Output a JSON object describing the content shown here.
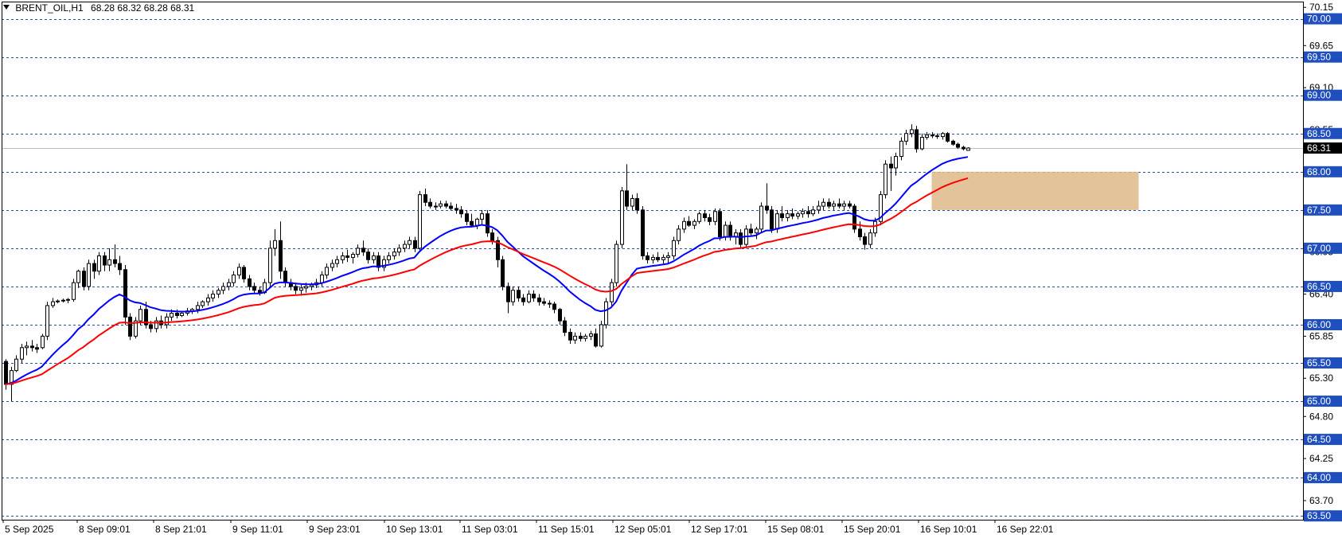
{
  "header": {
    "symbol": "BRENT_OIL,H1",
    "ohlc": "68.28 68.32 68.28 68.31"
  },
  "colors": {
    "background": "#ffffff",
    "level_line": "#1f4fbf",
    "bid_line": "#c0c0c0",
    "ma_fast": "#0000ff",
    "ma_slow": "#ff0000",
    "zone": "#deb887",
    "candle_bull": "#ffffff",
    "candle_bear": "#000000",
    "price_box": "#000000"
  },
  "chart_data": {
    "type": "candlestick",
    "symbol": "BRENT_OIL",
    "timeframe": "H1",
    "ylim": [
      63.5,
      70.15
    ],
    "y_ticks": [
      "70.15",
      "69.65",
      "69.10",
      "68.55",
      "68.00",
      "67.50",
      "66.95",
      "66.40",
      "65.85",
      "65.30",
      "64.80",
      "64.25",
      "63.70"
    ],
    "levels": [
      "70.00",
      "69.50",
      "69.00",
      "68.50",
      "68.00",
      "67.50",
      "67.00",
      "66.50",
      "66.00",
      "65.50",
      "65.00",
      "64.50",
      "64.00",
      "63.50"
    ],
    "current_price": "68.31",
    "x_labels": [
      "5 Sep 2025",
      "8 Sep 09:01",
      "8 Sep 21:01",
      "9 Sep 11:01",
      "9 Sep 23:01",
      "10 Sep 13:01",
      "11 Sep 03:01",
      "11 Sep 15:01",
      "12 Sep 05:01",
      "12 Sep 17:01",
      "15 Sep 08:01",
      "15 Sep 20:01",
      "16 Sep 10:01",
      "16 Sep 22:01"
    ],
    "zone": {
      "x_from": 179,
      "x_to": 219,
      "y_low": 67.5,
      "y_high": 68.0
    },
    "candles": [
      [
        65.52,
        65.55,
        65.15,
        65.22
      ],
      [
        65.22,
        65.45,
        65.0,
        65.4
      ],
      [
        65.4,
        65.6,
        65.38,
        65.55
      ],
      [
        65.55,
        65.75,
        65.5,
        65.7
      ],
      [
        65.7,
        65.78,
        65.6,
        65.72
      ],
      [
        65.72,
        65.8,
        65.65,
        65.7
      ],
      [
        65.7,
        65.75,
        65.63,
        65.68
      ],
      [
        65.7,
        65.88,
        65.68,
        65.85
      ],
      [
        65.85,
        66.3,
        65.8,
        66.25
      ],
      [
        66.25,
        66.35,
        66.22,
        66.3
      ],
      [
        66.3,
        66.33,
        66.28,
        66.31
      ],
      [
        66.31,
        66.34,
        66.29,
        66.32
      ],
      [
        66.32,
        66.35,
        66.28,
        66.33
      ],
      [
        66.33,
        66.6,
        66.3,
        66.55
      ],
      [
        66.55,
        66.72,
        66.48,
        66.7
      ],
      [
        66.7,
        66.75,
        66.45,
        66.5
      ],
      [
        66.5,
        66.85,
        66.45,
        66.8
      ],
      [
        66.8,
        66.85,
        66.6,
        66.7
      ],
      [
        66.7,
        66.95,
        66.65,
        66.9
      ],
      [
        66.9,
        66.95,
        66.7,
        66.78
      ],
      [
        66.78,
        67.0,
        66.7,
        66.85
      ],
      [
        66.85,
        67.05,
        66.75,
        66.8
      ],
      [
        66.8,
        66.9,
        66.65,
        66.72
      ],
      [
        66.72,
        66.78,
        66.0,
        66.1
      ],
      [
        66.1,
        66.15,
        65.8,
        65.85
      ],
      [
        65.85,
        66.1,
        65.82,
        66.05
      ],
      [
        66.05,
        66.25,
        66.0,
        66.2
      ],
      [
        66.2,
        66.3,
        65.95,
        66.0
      ],
      [
        66.0,
        66.05,
        65.9,
        65.95
      ],
      [
        65.95,
        66.1,
        65.9,
        66.05
      ],
      [
        66.05,
        66.12,
        65.95,
        66.0
      ],
      [
        66.0,
        66.15,
        65.95,
        66.1
      ],
      [
        66.1,
        66.2,
        66.05,
        66.15
      ],
      [
        66.15,
        66.2,
        66.08,
        66.12
      ],
      [
        66.12,
        66.18,
        66.1,
        66.15
      ],
      [
        66.15,
        66.22,
        66.12,
        66.18
      ],
      [
        66.18,
        66.22,
        66.14,
        66.2
      ],
      [
        66.2,
        66.3,
        66.15,
        66.25
      ],
      [
        66.25,
        66.32,
        66.22,
        66.3
      ],
      [
        66.3,
        66.4,
        66.25,
        66.35
      ],
      [
        66.35,
        66.45,
        66.3,
        66.4
      ],
      [
        66.4,
        66.48,
        66.35,
        66.45
      ],
      [
        66.45,
        66.55,
        66.4,
        66.5
      ],
      [
        66.5,
        66.6,
        66.45,
        66.55
      ],
      [
        66.55,
        66.7,
        66.5,
        66.65
      ],
      [
        66.65,
        66.8,
        66.6,
        66.75
      ],
      [
        66.75,
        66.78,
        66.55,
        66.6
      ],
      [
        66.6,
        66.65,
        66.45,
        66.5
      ],
      [
        66.5,
        66.55,
        66.4,
        66.45
      ],
      [
        66.45,
        66.5,
        66.38,
        66.42
      ],
      [
        66.42,
        66.6,
        66.4,
        66.55
      ],
      [
        66.55,
        67.1,
        66.5,
        67.0
      ],
      [
        67.0,
        67.25,
        66.9,
        67.1
      ],
      [
        67.1,
        67.35,
        66.6,
        66.7
      ],
      [
        66.7,
        66.75,
        66.5,
        66.55
      ],
      [
        66.55,
        66.6,
        66.45,
        66.5
      ],
      [
        66.5,
        66.55,
        66.4,
        66.45
      ],
      [
        66.45,
        66.52,
        66.38,
        66.48
      ],
      [
        66.48,
        66.55,
        66.42,
        66.5
      ],
      [
        66.5,
        66.55,
        66.45,
        66.52
      ],
      [
        66.52,
        66.6,
        66.48,
        66.55
      ],
      [
        66.55,
        66.7,
        66.5,
        66.65
      ],
      [
        66.65,
        66.8,
        66.6,
        66.75
      ],
      [
        66.75,
        66.85,
        66.7,
        66.8
      ],
      [
        66.8,
        66.9,
        66.75,
        66.85
      ],
      [
        66.85,
        66.95,
        66.8,
        66.9
      ],
      [
        66.9,
        66.98,
        66.82,
        66.88
      ],
      [
        66.88,
        66.95,
        66.8,
        66.92
      ],
      [
        66.92,
        67.05,
        66.88,
        67.0
      ],
      [
        67.0,
        67.1,
        66.9,
        66.95
      ],
      [
        66.95,
        67.0,
        66.8,
        66.85
      ],
      [
        66.85,
        66.95,
        66.8,
        66.9
      ],
      [
        66.9,
        66.95,
        66.7,
        66.75
      ],
      [
        66.75,
        66.9,
        66.7,
        66.85
      ],
      [
        66.85,
        66.95,
        66.8,
        66.9
      ],
      [
        66.9,
        67.0,
        66.85,
        66.95
      ],
      [
        66.95,
        67.05,
        66.9,
        67.0
      ],
      [
        67.0,
        67.1,
        66.95,
        67.05
      ],
      [
        67.05,
        67.15,
        67.0,
        67.1
      ],
      [
        67.1,
        67.15,
        66.95,
        67.0
      ],
      [
        67.0,
        67.75,
        66.95,
        67.7
      ],
      [
        67.7,
        67.78,
        67.55,
        67.6
      ],
      [
        67.6,
        67.65,
        67.52,
        67.55
      ],
      [
        67.55,
        67.6,
        67.5,
        67.55
      ],
      [
        67.55,
        67.62,
        67.52,
        67.58
      ],
      [
        67.58,
        67.62,
        67.52,
        67.55
      ],
      [
        67.55,
        67.6,
        67.5,
        67.52
      ],
      [
        67.52,
        67.58,
        67.45,
        67.5
      ],
      [
        67.5,
        67.55,
        67.4,
        67.45
      ],
      [
        67.45,
        67.5,
        67.3,
        67.35
      ],
      [
        67.35,
        67.45,
        67.28,
        67.3
      ],
      [
        67.3,
        67.4,
        67.25,
        67.38
      ],
      [
        67.38,
        67.5,
        67.3,
        67.45
      ],
      [
        67.45,
        67.5,
        67.15,
        67.2
      ],
      [
        67.2,
        67.25,
        67.05,
        67.1
      ],
      [
        67.1,
        67.15,
        66.75,
        66.85
      ],
      [
        66.85,
        66.9,
        66.45,
        66.5
      ],
      [
        66.5,
        66.55,
        66.15,
        66.3
      ],
      [
        66.3,
        66.5,
        66.25,
        66.45
      ],
      [
        66.45,
        66.5,
        66.3,
        66.35
      ],
      [
        66.35,
        66.4,
        66.25,
        66.3
      ],
      [
        66.3,
        66.45,
        66.28,
        66.4
      ],
      [
        66.4,
        66.45,
        66.3,
        66.35
      ],
      [
        66.35,
        66.4,
        66.25,
        66.3
      ],
      [
        66.3,
        66.35,
        66.25,
        66.28
      ],
      [
        66.28,
        66.32,
        66.22,
        66.27
      ],
      [
        66.27,
        66.3,
        66.15,
        66.2
      ],
      [
        66.2,
        66.22,
        66.0,
        66.05
      ],
      [
        66.05,
        66.1,
        65.85,
        65.9
      ],
      [
        65.9,
        65.95,
        65.75,
        65.8
      ],
      [
        65.8,
        65.9,
        65.75,
        65.85
      ],
      [
        65.85,
        65.9,
        65.78,
        65.82
      ],
      [
        65.82,
        65.88,
        65.78,
        65.85
      ],
      [
        65.85,
        65.92,
        65.8,
        65.88
      ],
      [
        65.88,
        65.95,
        65.7,
        65.72
      ],
      [
        65.72,
        66.05,
        65.7,
        66.0
      ],
      [
        66.0,
        66.35,
        65.95,
        66.3
      ],
      [
        66.3,
        66.6,
        66.25,
        66.55
      ],
      [
        66.55,
        67.1,
        66.5,
        67.05
      ],
      [
        67.05,
        67.8,
        67.0,
        67.75
      ],
      [
        67.75,
        68.1,
        67.5,
        67.55
      ],
      [
        67.55,
        67.7,
        67.5,
        67.65
      ],
      [
        67.65,
        67.72,
        67.45,
        67.5
      ],
      [
        67.5,
        67.55,
        66.85,
        66.9
      ],
      [
        66.9,
        66.95,
        66.8,
        66.85
      ],
      [
        66.85,
        66.92,
        66.8,
        66.88
      ],
      [
        66.88,
        66.95,
        66.82,
        66.85
      ],
      [
        66.85,
        66.92,
        66.8,
        66.88
      ],
      [
        66.88,
        66.95,
        66.8,
        66.9
      ],
      [
        66.9,
        67.15,
        66.85,
        67.1
      ],
      [
        67.1,
        67.3,
        67.05,
        67.25
      ],
      [
        67.25,
        67.4,
        67.2,
        67.35
      ],
      [
        67.35,
        67.42,
        67.28,
        67.3
      ],
      [
        67.3,
        67.38,
        67.25,
        67.35
      ],
      [
        67.35,
        67.48,
        67.32,
        67.45
      ],
      [
        67.45,
        67.5,
        67.35,
        67.4
      ],
      [
        67.4,
        67.45,
        67.3,
        67.35
      ],
      [
        67.35,
        67.52,
        67.3,
        67.48
      ],
      [
        67.48,
        67.52,
        67.1,
        67.15
      ],
      [
        67.15,
        67.35,
        67.1,
        67.3
      ],
      [
        67.3,
        67.35,
        67.1,
        67.15
      ],
      [
        67.15,
        67.25,
        67.05,
        67.2
      ],
      [
        67.2,
        67.25,
        67.0,
        67.05
      ],
      [
        67.05,
        67.3,
        67.0,
        67.25
      ],
      [
        67.25,
        67.32,
        67.15,
        67.2
      ],
      [
        67.2,
        67.28,
        67.12,
        67.25
      ],
      [
        67.25,
        67.6,
        67.2,
        67.55
      ],
      [
        67.55,
        67.85,
        67.45,
        67.5
      ],
      [
        67.5,
        67.55,
        67.2,
        67.25
      ],
      [
        67.25,
        67.5,
        67.2,
        67.45
      ],
      [
        67.45,
        67.55,
        67.35,
        67.4
      ],
      [
        67.4,
        67.5,
        67.35,
        67.45
      ],
      [
        67.45,
        67.52,
        67.38,
        67.42
      ],
      [
        67.42,
        67.48,
        67.38,
        67.45
      ],
      [
        67.45,
        67.52,
        67.4,
        67.48
      ],
      [
        67.48,
        67.55,
        67.4,
        67.45
      ],
      [
        67.45,
        67.55,
        67.42,
        67.5
      ],
      [
        67.5,
        67.62,
        67.45,
        67.55
      ],
      [
        67.55,
        67.65,
        67.5,
        67.6
      ],
      [
        67.6,
        67.65,
        67.52,
        67.55
      ],
      [
        67.55,
        67.62,
        67.5,
        67.58
      ],
      [
        67.58,
        67.65,
        67.52,
        67.55
      ],
      [
        67.55,
        67.62,
        67.5,
        67.58
      ],
      [
        67.58,
        67.62,
        67.52,
        67.55
      ],
      [
        67.55,
        67.58,
        67.2,
        67.25
      ],
      [
        67.25,
        67.35,
        67.1,
        67.15
      ],
      [
        67.15,
        67.2,
        66.98,
        67.05
      ],
      [
        67.05,
        67.25,
        67.0,
        67.2
      ],
      [
        67.2,
        67.4,
        67.15,
        67.35
      ],
      [
        67.35,
        67.75,
        67.3,
        67.7
      ],
      [
        67.7,
        68.15,
        67.65,
        68.1
      ],
      [
        68.1,
        68.2,
        67.75,
        68.05
      ],
      [
        68.05,
        68.25,
        67.95,
        68.2
      ],
      [
        68.2,
        68.45,
        68.15,
        68.4
      ],
      [
        68.4,
        68.55,
        68.35,
        68.5
      ],
      [
        68.5,
        68.62,
        68.45,
        68.55
      ],
      [
        68.55,
        68.6,
        68.25,
        68.3
      ],
      [
        68.3,
        68.5,
        68.28,
        68.45
      ],
      [
        68.45,
        68.52,
        68.42,
        68.48
      ],
      [
        68.48,
        68.52,
        68.44,
        68.47
      ],
      [
        68.47,
        68.5,
        68.43,
        68.46
      ],
      [
        68.46,
        68.52,
        68.42,
        68.5
      ],
      [
        68.5,
        68.52,
        68.38,
        68.4
      ],
      [
        68.4,
        68.42,
        68.34,
        68.36
      ],
      [
        68.36,
        68.38,
        68.3,
        68.32
      ],
      [
        68.32,
        68.34,
        68.28,
        68.3
      ],
      [
        68.28,
        68.32,
        68.28,
        68.31
      ]
    ]
  }
}
